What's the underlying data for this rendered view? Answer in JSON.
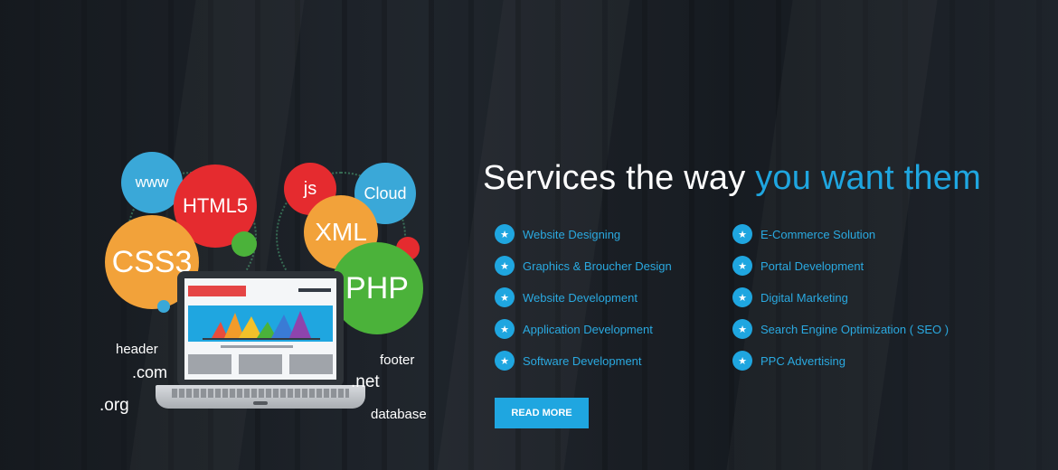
{
  "hero": {
    "headline_main": "Services the way",
    "headline_accent": "you want them",
    "read_more_label": "READ MORE"
  },
  "services_left": [
    "Website Designing",
    "Graphics & Broucher Design",
    "Website Development",
    "Application Development",
    "Software Development"
  ],
  "services_right": [
    "E-Commerce Solution",
    "Portal Development",
    "Digital Marketing",
    "Search Engine Optimization ( SEO )",
    "PPC Advertising"
  ],
  "illustration": {
    "bubbles": {
      "www": "www",
      "html5": "HTML5",
      "css3": "CSS3",
      "js": "js",
      "cloud": "Cloud",
      "xml": "XML",
      "php": "PHP"
    },
    "words": {
      "header": "header",
      "com": ".com",
      "org": ".org",
      "footer": "footer",
      "net": ".net",
      "database": "database"
    }
  },
  "colors": {
    "accent": "#1fa6e0",
    "bubble_blue": "#3aa8d8",
    "bubble_red": "#e52b2f",
    "bubble_orange": "#f2a23a",
    "bubble_green": "#4bb23a"
  },
  "icons": {
    "service_bullet": "star-icon"
  }
}
